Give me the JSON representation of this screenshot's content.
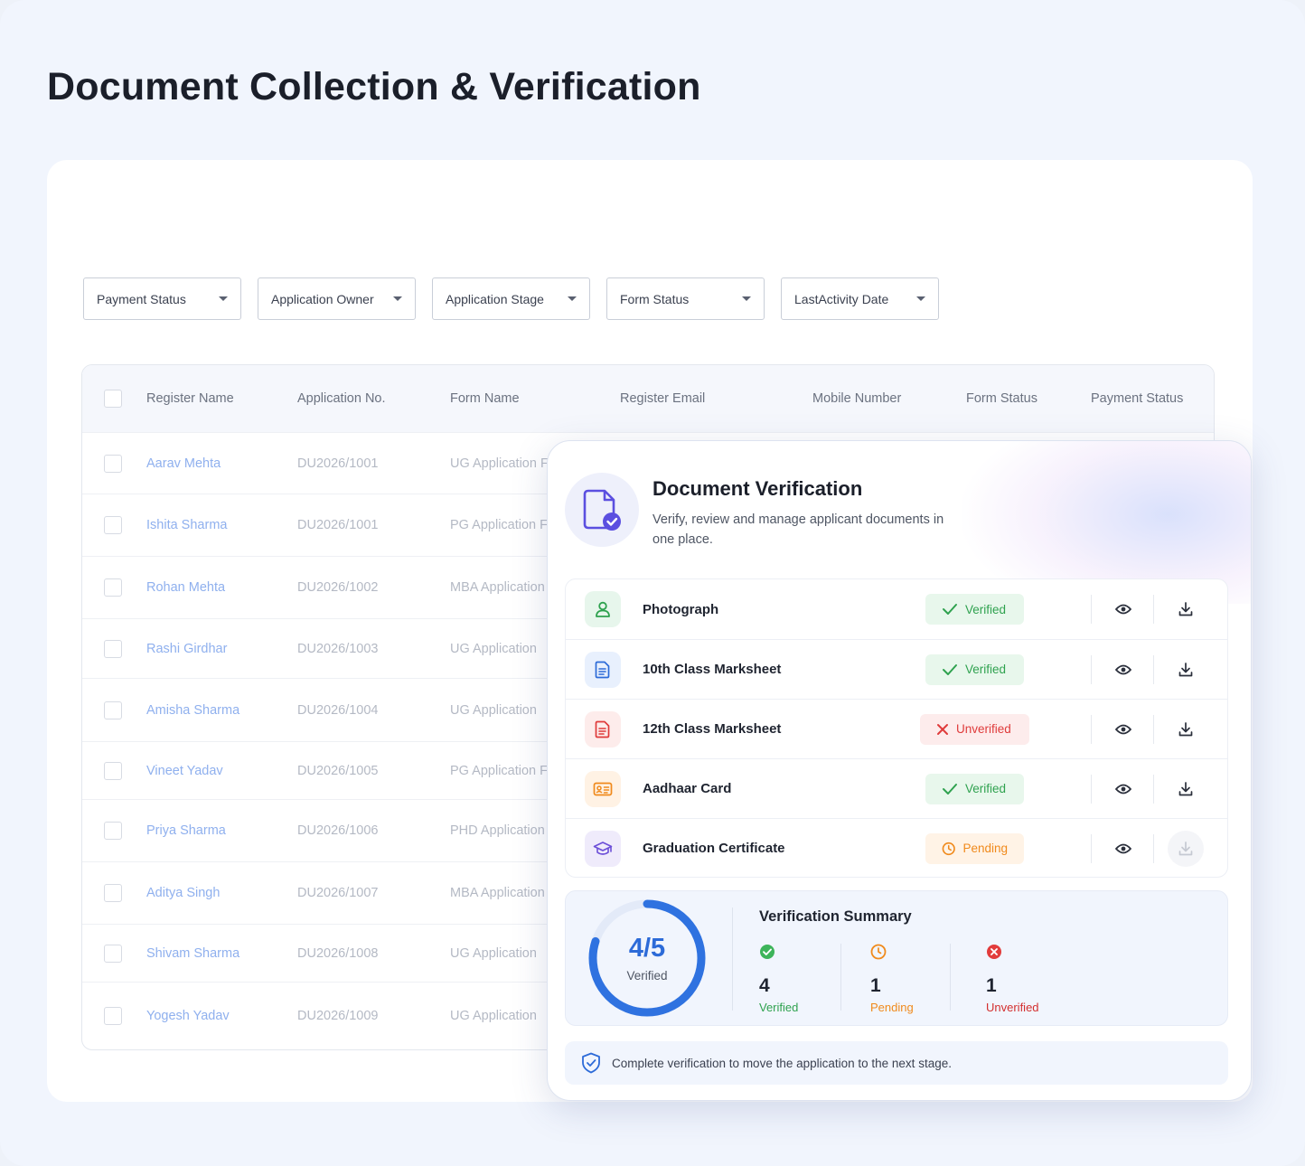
{
  "page": {
    "title": "Document Collection & Verification"
  },
  "filters": [
    {
      "label": "Payment Status"
    },
    {
      "label": "Application Owner"
    },
    {
      "label": "Application Stage"
    },
    {
      "label": "Form Status"
    },
    {
      "label": "LastActivity Date"
    }
  ],
  "table": {
    "headers": {
      "name": "Register Name",
      "app_no": "Application No.",
      "form": "Form Name",
      "email": "Register Email",
      "mobile": "Mobile Number",
      "form_status": "Form Status",
      "payment_status": "Payment Status"
    },
    "rows": [
      {
        "name": "Aarav Mehta",
        "app_no": "DU2026/1001",
        "form": "UG Application F"
      },
      {
        "name": "Ishita Sharma",
        "app_no": "DU2026/1001",
        "form": "PG Application F"
      },
      {
        "name": "Rohan Mehta",
        "app_no": "DU2026/1002",
        "form": "MBA Application"
      },
      {
        "name": "Rashi Girdhar",
        "app_no": "DU2026/1003",
        "form": "UG Application"
      },
      {
        "name": "Amisha Sharma",
        "app_no": "DU2026/1004",
        "form": "UG Application"
      },
      {
        "name": "Vineet Yadav",
        "app_no": "DU2026/1005",
        "form": "PG Application F"
      },
      {
        "name": "Priya Sharma",
        "app_no": "DU2026/1006",
        "form": "PHD Application"
      },
      {
        "name": "Aditya Singh",
        "app_no": "DU2026/1007",
        "form": "MBA Application"
      },
      {
        "name": "Shivam Sharma",
        "app_no": "DU2026/1008",
        "form": "UG Application"
      },
      {
        "name": "Yogesh Yadav",
        "app_no": "DU2026/1009",
        "form": "UG Application"
      }
    ]
  },
  "panel": {
    "title": "Document Verification",
    "subtitle": "Verify, review and manage applicant documents in one place.",
    "icon": "document-check-icon",
    "documents": [
      {
        "name": "Photograph",
        "icon": "user-icon",
        "status": "Verified"
      },
      {
        "name": "10th Class Marksheet",
        "icon": "file-text-icon",
        "status": "Verified"
      },
      {
        "name": "12th Class Marksheet",
        "icon": "file-text-icon",
        "status": "Unverified"
      },
      {
        "name": "Aadhaar Card",
        "icon": "id-card-icon",
        "status": "Verified"
      },
      {
        "name": "Graduation Certificate",
        "icon": "graduation-cap-icon",
        "status": "Pending"
      }
    ],
    "summary": {
      "title": "Verification Summary",
      "progress_text": "4/5",
      "progress_label": "Verified",
      "progress_fraction": 0.8,
      "verified": {
        "count": "4",
        "label": "Verified"
      },
      "pending": {
        "count": "1",
        "label": "Pending"
      },
      "unverified": {
        "count": "1",
        "label": "Unverified"
      }
    },
    "note": "Complete verification to move the application to the next stage."
  },
  "colors": {
    "accent": "#2d6bd8",
    "verified": "#2fa24f",
    "pending": "#f08a1c",
    "unverified": "#df3b3b",
    "link": "#8fb0ee"
  }
}
